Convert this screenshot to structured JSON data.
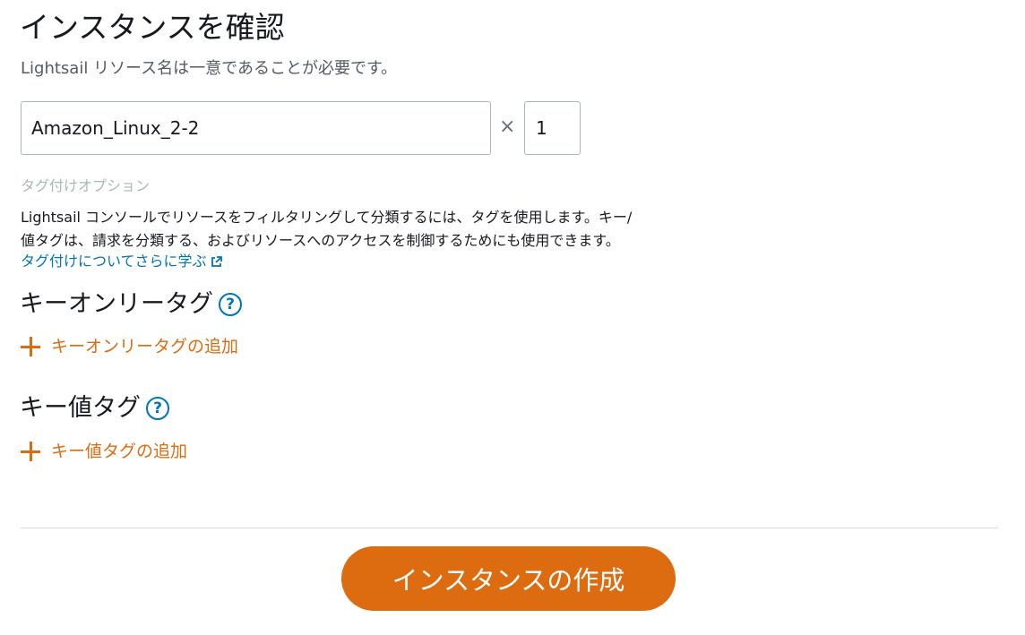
{
  "header": {
    "title": "インスタンスを確認",
    "subtitle": "Lightsail リソース名は一意であることが必要です。"
  },
  "instance": {
    "name_value": "Amazon_Linux_2-2",
    "times_symbol": "×",
    "count_value": "1"
  },
  "tags": {
    "option_label": "タグ付けオプション",
    "description_line1": "Lightsail コンソールでリソースをフィルタリングして分類するには、タグを使用します。キー/",
    "description_line2": "値タグは、請求を分類する、およびリソースへのアクセスを制御するためにも使用できます。",
    "learn_more_link": "タグ付けについてさらに学ぶ",
    "key_only": {
      "title": "キーオンリータグ",
      "help_symbol": "?",
      "add_label": "キーオンリータグの追加"
    },
    "key_value": {
      "title": "キー値タグ",
      "help_symbol": "?",
      "add_label": "キー値タグの追加"
    }
  },
  "footer": {
    "create_button_label": "インスタンスの作成"
  },
  "colors": {
    "accent_orange": "#dd6b10",
    "link_blue": "#0073bb",
    "muted_gray": "#aab7b8",
    "secondary_text": "#545b64"
  }
}
